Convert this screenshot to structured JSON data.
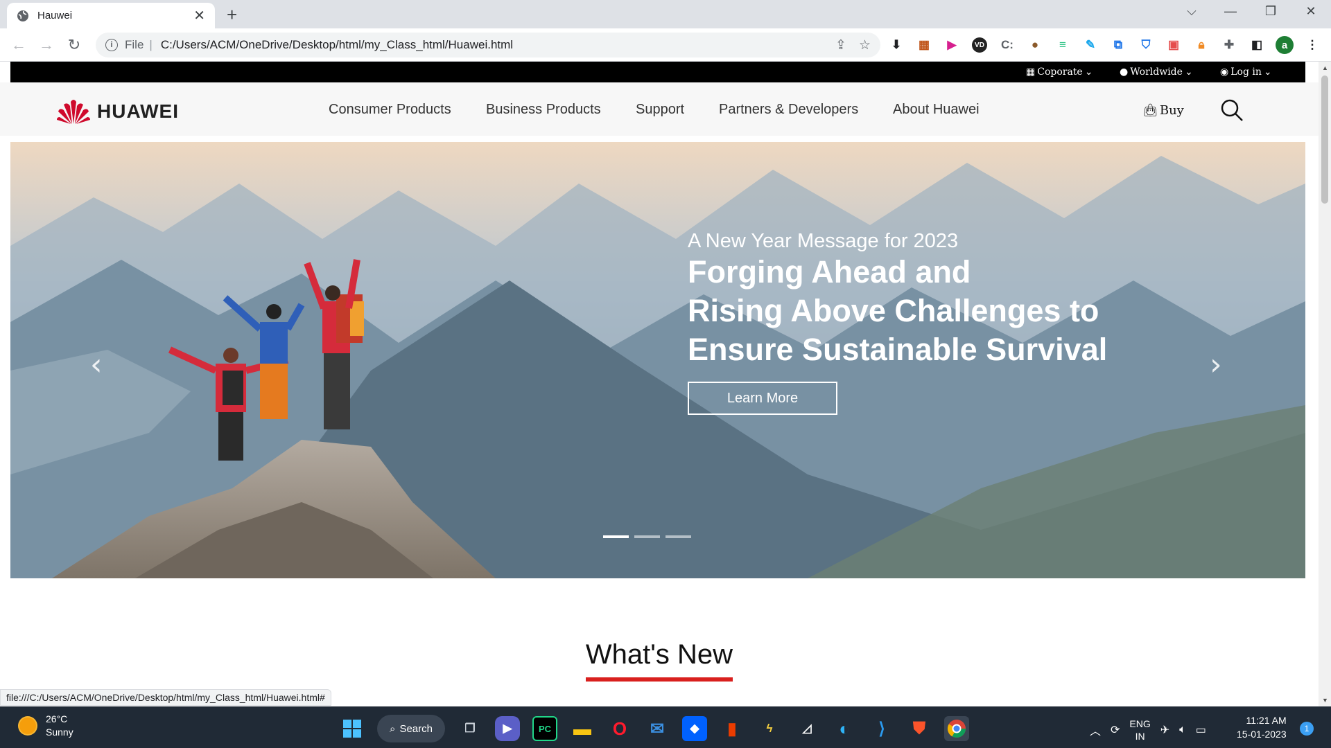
{
  "browser": {
    "tab_title": "Hauwei",
    "address_scheme": "File",
    "address_path": "C:/Users/ACM/OneDrive/Desktop/html/my_Class_html/Huawei.html",
    "profile_initial": "a",
    "status_url": "file:///C:/Users/ACM/OneDrive/Desktop/html/my_Class_html/Huawei.html#"
  },
  "topbar": {
    "corporate": "Coporate",
    "worldwide": "Worldwide",
    "login": "Log in"
  },
  "nav": {
    "brand": "HUAWEI",
    "items": [
      "Consumer Products",
      "Business Products",
      "Support",
      "Partners & Developers",
      "About Huawei"
    ],
    "buy": "Buy"
  },
  "hero": {
    "subtitle": "A New Year Message for 2023",
    "title_line1": "Forging Ahead and",
    "title_line2": "Rising Above Challenges to",
    "title_line3": "Ensure Sustainable Survival",
    "button": "Learn More",
    "slides_total": 3,
    "active_slide": 1
  },
  "section": {
    "title": "What's New",
    "accent_color": "#d9201e"
  },
  "taskbar": {
    "temperature": "26°C",
    "weather": "Sunny",
    "search": "Search",
    "lang_line1": "ENG",
    "lang_line2": "IN",
    "time": "11:21 AM",
    "date": "15-01-2023",
    "notifications": "1"
  }
}
